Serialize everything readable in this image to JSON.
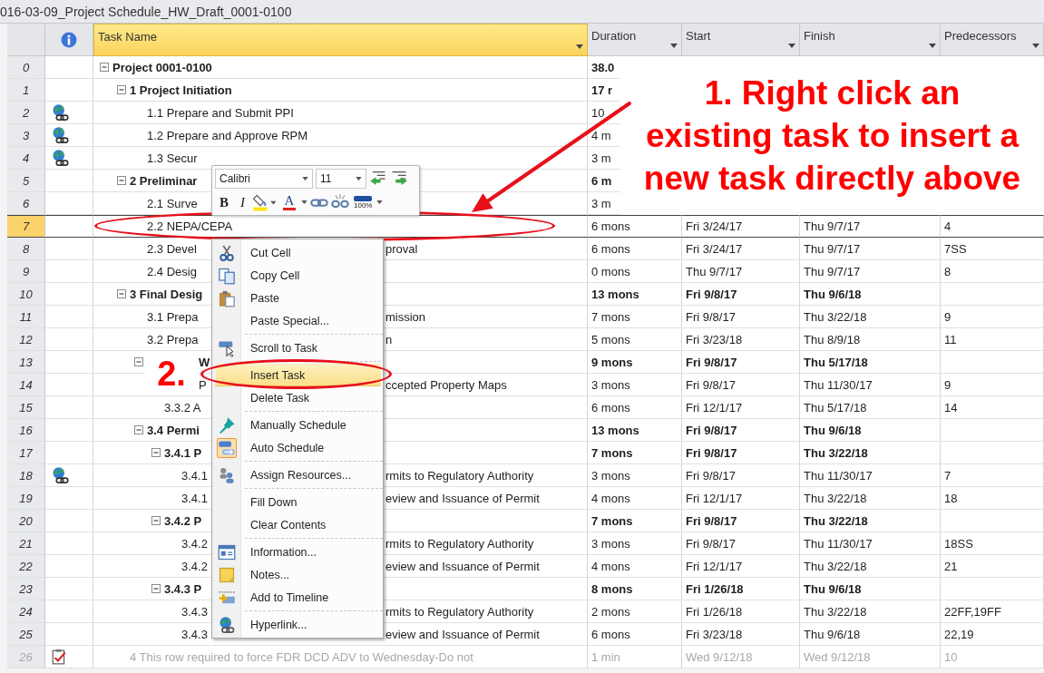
{
  "window": {
    "title": "016-03-09_Project Schedule_HW_Draft_0001-0100"
  },
  "columns": [
    {
      "label": "Task Name",
      "selected": true
    },
    {
      "label": "Duration",
      "selected": false
    },
    {
      "label": "Start",
      "selected": false
    },
    {
      "label": "Finish",
      "selected": false
    },
    {
      "label": "Predecessors",
      "selected": false
    }
  ],
  "rows": [
    {
      "id": "0",
      "name": "Project 0001-0100",
      "duration": "38.0",
      "expanded": true,
      "selected": false,
      "inactive": false,
      "children": [
        {
          "id": "1",
          "name": "1 Project Initiation",
          "duration": "17 r",
          "expanded": true,
          "selected": false,
          "inactive": false,
          "children": [
            {
              "id": "2",
              "name": "1.1 Prepare and Submit PPI",
              "duration": "10",
              "kind": "hyperlink",
              "selected": false,
              "inactive": false
            },
            {
              "id": "3",
              "name": "1.2 Prepare and Approve RPM",
              "duration": "4 m",
              "kind": "hyperlink",
              "selected": false,
              "inactive": false
            },
            {
              "id": "4",
              "name": "1.3 Secur",
              "duration": "3 m",
              "kind": "hyperlink",
              "selected": false,
              "inactive": false
            }
          ]
        },
        {
          "id": "5",
          "name": "2 Preliminar",
          "duration": "6 m",
          "expanded": true,
          "selected": false,
          "inactive": false,
          "children": [
            {
              "id": "6",
              "name": "2.1 Surve",
              "duration": "3 m",
              "selected": false,
              "inactive": false
            },
            {
              "id": "7",
              "name": "2.2 NEPA/CEPA",
              "duration": "6 mons",
              "start": "Fri 3/24/17",
              "finish": "Thu 9/7/17",
              "predecessors": "4",
              "selected": true,
              "inactive": false
            },
            {
              "id": "8",
              "name": "2.3 Devel",
              "name_right": "proval",
              "duration": "6 mons",
              "start": "Fri 3/24/17",
              "finish": "Thu 9/7/17",
              "predecessors": "7SS",
              "selected": false,
              "inactive": false
            },
            {
              "id": "9",
              "name": "2.4 Desig",
              "duration": "0 mons",
              "start": "Thu 9/7/17",
              "finish": "Thu 9/7/17",
              "predecessors": "8",
              "selected": false,
              "inactive": false
            }
          ]
        },
        {
          "id": "10",
          "name": "3 Final Desig",
          "duration": "13 mons",
          "start": "Fri 9/8/17",
          "finish": "Thu 9/6/18",
          "expanded": true,
          "selected": false,
          "inactive": false,
          "children": [
            {
              "id": "11",
              "name": "3.1 Prepa",
              "name_right": "mission",
              "duration": "7 mons",
              "start": "Fri 9/8/17",
              "finish": "Thu 3/22/18",
              "predecessors": "9",
              "selected": false,
              "inactive": false
            },
            {
              "id": "12",
              "name": "3.2 Prepa",
              "name_right": "n",
              "duration": "5 mons",
              "start": "Fri 3/23/18",
              "finish": "Thu 8/9/18",
              "predecessors": "11",
              "selected": false,
              "inactive": false
            },
            {
              "id": "13",
              "name": "W",
              "clipped": true,
              "duration": "9 mons",
              "start": "Fri 9/8/17",
              "finish": "Thu 5/17/18",
              "expanded": true,
              "selected": false,
              "inactive": false,
              "children": [
                {
                  "id": "14",
                  "name": "P",
                  "name_right": "ccepted Property Maps",
                  "clipped": true,
                  "duration": "3 mons",
                  "start": "Fri 9/8/17",
                  "finish": "Thu 11/30/17",
                  "predecessors": "9",
                  "selected": false,
                  "inactive": false
                },
                {
                  "id": "15",
                  "name": "3.3.2 A",
                  "duration": "6 mons",
                  "start": "Fri 12/1/17",
                  "finish": "Thu 5/17/18",
                  "predecessors": "14",
                  "selected": false,
                  "inactive": false
                }
              ]
            },
            {
              "id": "16",
              "name": "3.4 Permi",
              "duration": "13 mons",
              "start": "Fri 9/8/17",
              "finish": "Thu 9/6/18",
              "expanded": true,
              "selected": false,
              "inactive": false,
              "children": [
                {
                  "id": "17",
                  "name": "3.4.1 P",
                  "duration": "7 mons",
                  "start": "Fri 9/8/17",
                  "finish": "Thu 3/22/18",
                  "expanded": true,
                  "selected": false,
                  "inactive": false,
                  "children": [
                    {
                      "id": "18",
                      "name": "3.4.1",
                      "name_right": "rmits to Regulatory Authority",
                      "duration": "3 mons",
                      "start": "Fri 9/8/17",
                      "finish": "Thu 11/30/17",
                      "predecessors": "7",
                      "kind": "hyperlink",
                      "selected": false,
                      "inactive": false
                    },
                    {
                      "id": "19",
                      "name": "3.4.1",
                      "name_right": "eview and Issuance of Permit",
                      "duration": "4 mons",
                      "start": "Fri 12/1/17",
                      "finish": "Thu 3/22/18",
                      "predecessors": "18",
                      "selected": false,
                      "inactive": false
                    }
                  ]
                },
                {
                  "id": "20",
                  "name": "3.4.2 P",
                  "duration": "7 mons",
                  "start": "Fri 9/8/17",
                  "finish": "Thu 3/22/18",
                  "expanded": true,
                  "selected": false,
                  "inactive": false,
                  "children": [
                    {
                      "id": "21",
                      "name": "3.4.2",
                      "name_right": "rmits to Regulatory Authority",
                      "duration": "3 mons",
                      "start": "Fri 9/8/17",
                      "finish": "Thu 11/30/17",
                      "predecessors": "18SS",
                      "selected": false,
                      "inactive": false
                    },
                    {
                      "id": "22",
                      "name": "3.4.2",
                      "name_right": "eview and Issuance of Permit",
                      "duration": "4 mons",
                      "start": "Fri 12/1/17",
                      "finish": "Thu 3/22/18",
                      "predecessors": "21",
                      "selected": false,
                      "inactive": false
                    }
                  ]
                },
                {
                  "id": "23",
                  "name": "3.4.3 P",
                  "duration": "8 mons",
                  "start": "Fri 1/26/18",
                  "finish": "Thu 9/6/18",
                  "expanded": true,
                  "selected": false,
                  "inactive": false,
                  "children": [
                    {
                      "id": "24",
                      "name": "3.4.3",
                      "name_right": "rmits to Regulatory Authority",
                      "duration": "2 mons",
                      "start": "Fri 1/26/18",
                      "finish": "Thu 3/22/18",
                      "predecessors": "22FF,19FF",
                      "selected": false,
                      "inactive": false
                    },
                    {
                      "id": "25",
                      "name": "3.4.3",
                      "name_right": "eview and Issuance of Permit",
                      "duration": "6 mons",
                      "start": "Fri 3/23/18",
                      "finish": "Thu 9/6/18",
                      "predecessors": "22,19",
                      "selected": false,
                      "inactive": false
                    }
                  ]
                }
              ]
            }
          ]
        },
        {
          "id": "26",
          "name": "4 This row required to force FDR DCD ADV to Wednesday-Do not",
          "duration": "1 min",
          "start": "Wed 9/12/18",
          "finish": "Wed 9/12/18",
          "predecessors": "10",
          "kind": "status",
          "selected": false,
          "inactive": true
        }
      ]
    }
  ],
  "mini_toolbar": {
    "font": "Calibri",
    "size": "11",
    "bold": "B",
    "italic": "I",
    "font_color": "A",
    "zoom": "100%"
  },
  "context_menu": {
    "items": [
      {
        "label": "Cut Cell",
        "selected": false,
        "checked": false,
        "separator_before": false
      },
      {
        "label": "Copy Cell",
        "selected": false,
        "checked": false,
        "separator_before": false
      },
      {
        "label": "Paste",
        "selected": false,
        "checked": false,
        "separator_before": false
      },
      {
        "label": "Paste Special...",
        "selected": false,
        "checked": false,
        "separator_before": false
      },
      {
        "label": "Scroll to Task",
        "selected": false,
        "checked": false,
        "separator_before": true
      },
      {
        "label": "Insert Task",
        "selected": true,
        "checked": false,
        "separator_before": true
      },
      {
        "label": "Delete Task",
        "selected": false,
        "checked": false,
        "separator_before": false
      },
      {
        "label": "Manually Schedule",
        "selected": false,
        "checked": false,
        "separator_before": true
      },
      {
        "label": "Auto Schedule",
        "selected": false,
        "checked": true,
        "separator_before": false
      },
      {
        "label": "Assign Resources...",
        "selected": false,
        "checked": false,
        "separator_before": true
      },
      {
        "label": "Fill Down",
        "selected": false,
        "checked": false,
        "separator_before": true
      },
      {
        "label": "Clear Contents",
        "selected": false,
        "checked": false,
        "separator_before": false
      },
      {
        "label": "Information...",
        "selected": false,
        "checked": false,
        "separator_before": true
      },
      {
        "label": "Notes...",
        "selected": false,
        "checked": false,
        "separator_before": false
      },
      {
        "label": "Add to Timeline",
        "selected": false,
        "checked": false,
        "separator_before": false
      },
      {
        "label": "Hyperlink...",
        "selected": false,
        "checked": false,
        "separator_before": true
      }
    ]
  },
  "annotations": {
    "callout": [
      "1. Right click an",
      "existing task to insert a",
      "new task directly above"
    ],
    "step_label": "2."
  }
}
